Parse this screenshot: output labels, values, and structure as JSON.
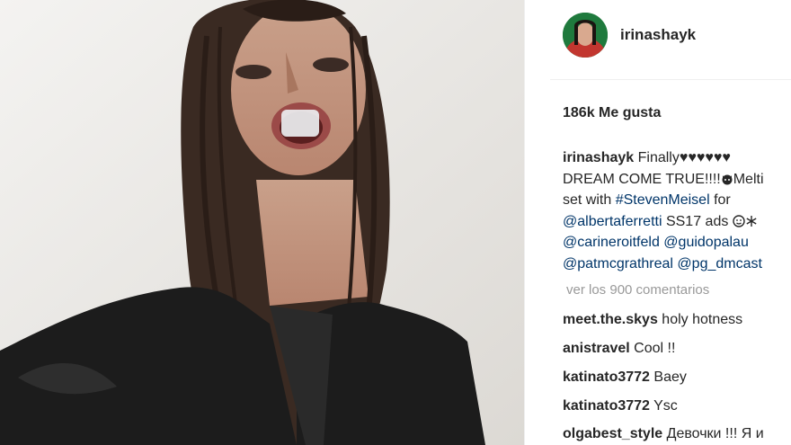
{
  "post": {
    "image_alt": "photo",
    "account": {
      "username": "irinashayk"
    },
    "likes_text": "186k Me gusta",
    "caption": {
      "username": "irinashayk",
      "lines": [
        {
          "text": "Finally♥♥♥♥♥♥"
        },
        {
          "text": "DREAM COME TRUE!!!!",
          "after_emoji": "Melti"
        },
        {
          "prefix": "set with ",
          "link": "#StevenMeisel",
          "suffix": " for"
        },
        {
          "link": "@albertaferretti",
          "suffix": " SS17 ads "
        },
        {
          "link1": "@carineroitfeld",
          "link2": "@guidopalau"
        },
        {
          "link1": "@patmcgrathreal",
          "link2": "@pg_dmcast"
        }
      ]
    },
    "view_all_comments": "ver los 900 comentarios",
    "comments": [
      {
        "username": "meet.the.skys",
        "text": "holy hotness"
      },
      {
        "username": "anistravel",
        "text": "Cool !!"
      },
      {
        "username": "katinato3772",
        "text": "Baey"
      },
      {
        "username": "katinato3772",
        "text": "Ysc"
      },
      {
        "username": "olgabest_style",
        "text": "Девочки !!! Я и"
      }
    ]
  }
}
